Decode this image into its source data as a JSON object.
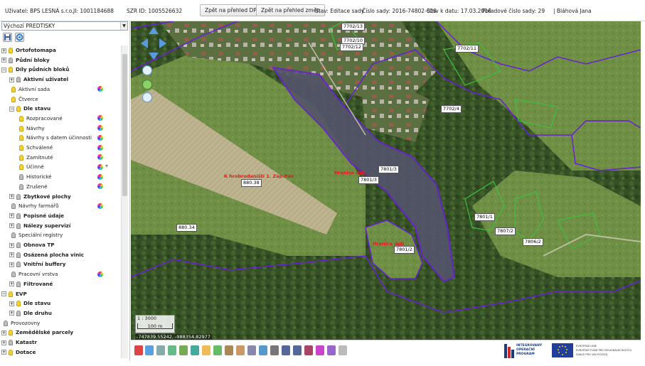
{
  "topbar": {
    "user": "Uživatel: BPS LESNÁ s.r.o.",
    "ji": "JI: 1001184688",
    "szr": "SZR ID: 1005526632",
    "btn_dpb": "Zpět na přehled DPB",
    "btn_zmen": "Zpět na přehled změn",
    "stav": "Stav: Editace sady",
    "cislo": "Číslo sady: 2016-74802-029",
    "datum": "Stav k datu: 17.03.2016",
    "poradove": "Pořadové číslo sady: 29",
    "person": "| Bláhová Jana"
  },
  "layer_select": "Výchozí PREDTISKY",
  "tree": [
    {
      "label": "Ortofotomapa",
      "indent": 0,
      "bold": true,
      "bulb": "on",
      "expander": "+"
    },
    {
      "label": "Půdní bloky",
      "indent": 0,
      "bold": true,
      "bulb": "off",
      "expander": "+"
    },
    {
      "label": "Díly půdních bloků",
      "indent": 0,
      "bold": true,
      "bulb": "on",
      "expander": "-"
    },
    {
      "label": "Aktivní uživatel",
      "indent": 1,
      "bold": true,
      "bulb": "off",
      "expander": "+"
    },
    {
      "label": "Aktivní sada",
      "indent": 1,
      "bold": false,
      "bulb": "on",
      "expander": "",
      "wheel": true
    },
    {
      "label": "Čtverce",
      "indent": 1,
      "bold": false,
      "bulb": "on",
      "expander": ""
    },
    {
      "label": "Dle stavu",
      "indent": 1,
      "bold": true,
      "bulb": "on",
      "expander": "-"
    },
    {
      "label": "Rozpracované",
      "indent": 2,
      "bold": false,
      "bulb": "on",
      "expander": "",
      "wheel": true
    },
    {
      "label": "Návrhy",
      "indent": 2,
      "bold": false,
      "bulb": "on",
      "expander": "",
      "wheel": true
    },
    {
      "label": "Návrhy s datem účinnosti",
      "indent": 2,
      "bold": false,
      "bulb": "on",
      "expander": "",
      "wheel": true
    },
    {
      "label": "Schválené",
      "indent": 2,
      "bold": false,
      "bulb": "on",
      "expander": "",
      "wheel": true
    },
    {
      "label": "Zamítnuté",
      "indent": 2,
      "bold": false,
      "bulb": "on",
      "expander": "",
      "wheel": true
    },
    {
      "label": "Účinné",
      "indent": 2,
      "bold": false,
      "bulb": "on",
      "expander": "",
      "wheel": true,
      "filter": true
    },
    {
      "label": "Historické",
      "indent": 2,
      "bold": false,
      "bulb": "off",
      "expander": "",
      "wheel": true
    },
    {
      "label": "Zrušené",
      "indent": 2,
      "bold": false,
      "bulb": "off",
      "expander": "",
      "wheel": true
    },
    {
      "label": "Zbytkové plochy",
      "indent": 1,
      "bold": true,
      "bulb": "off",
      "expander": "+"
    },
    {
      "label": "Návrhy farmářů",
      "indent": 1,
      "bold": false,
      "bulb": "off",
      "expander": "",
      "wheel": true
    },
    {
      "label": "Popisné údaje",
      "indent": 1,
      "bold": true,
      "bulb": "off",
      "expander": "+"
    },
    {
      "label": "Nálezy supervizí",
      "indent": 1,
      "bold": true,
      "bulb": "off",
      "expander": "+"
    },
    {
      "label": "Speciální registry",
      "indent": 1,
      "bold": false,
      "bulb": "off",
      "expander": ""
    },
    {
      "label": "Obnova TP",
      "indent": 1,
      "bold": true,
      "bulb": "off",
      "expander": "+"
    },
    {
      "label": "Osázená plocha vinic",
      "indent": 1,
      "bold": true,
      "bulb": "off",
      "expander": "+"
    },
    {
      "label": "Vnitřní buffery",
      "indent": 1,
      "bold": true,
      "bulb": "off",
      "expander": "+"
    },
    {
      "label": "Pracovní vrstva",
      "indent": 1,
      "bold": false,
      "bulb": "off",
      "expander": "",
      "wheel": true
    },
    {
      "label": "Filtrované",
      "indent": 1,
      "bold": true,
      "bulb": "off",
      "expander": "+"
    },
    {
      "label": "EVP",
      "indent": 0,
      "bold": true,
      "bulb": "on",
      "expander": "-"
    },
    {
      "label": "Dle stavu",
      "indent": 1,
      "bold": true,
      "bulb": "on",
      "expander": "+"
    },
    {
      "label": "Dle druhu",
      "indent": 1,
      "bold": true,
      "bulb": "off",
      "expander": "+"
    },
    {
      "label": "Provozovny",
      "indent": 0,
      "bold": false,
      "bulb": "off",
      "expander": ""
    },
    {
      "label": "Zemědělské parcely",
      "indent": 0,
      "bold": true,
      "bulb": "on",
      "expander": "+"
    },
    {
      "label": "Katastr",
      "indent": 0,
      "bold": true,
      "bulb": "off",
      "expander": "+"
    },
    {
      "label": "Dotace",
      "indent": 0,
      "bold": true,
      "bulb": "on",
      "expander": "+"
    }
  ],
  "map": {
    "parcel_labels": [
      "7702/13",
      "7702/10",
      "7702/12",
      "7702/11",
      "7702/4",
      "7801/3",
      "7801/3",
      "880.38",
      "880.34",
      "7801/1",
      "7807/2",
      "7806/2",
      "7801/2"
    ],
    "red_labels": [
      "K hrobrodaništi 1. Záp.Pás",
      "Hranice dpb",
      "Hranice dpb"
    ],
    "scale_ratio": "1 : 3000",
    "scale_bar": "100 m",
    "coords": "-747839.55242, -988354.82977"
  },
  "colors": {
    "parcel_line": "#6a1fd6",
    "green_line": "#3fbf3f",
    "label_red": "#e8171b"
  },
  "logos": {
    "iop": [
      "INTEGROVANÝ",
      "OPERAČNÍ",
      "PROGRAM"
    ],
    "eu": [
      "EVROPSKÁ UNIE",
      "EVROPSKÝ FOND PRO REGIONÁLNÍ ROZVOJ",
      "ŠANCE PRO VÁŠ ROZVOJ"
    ]
  }
}
